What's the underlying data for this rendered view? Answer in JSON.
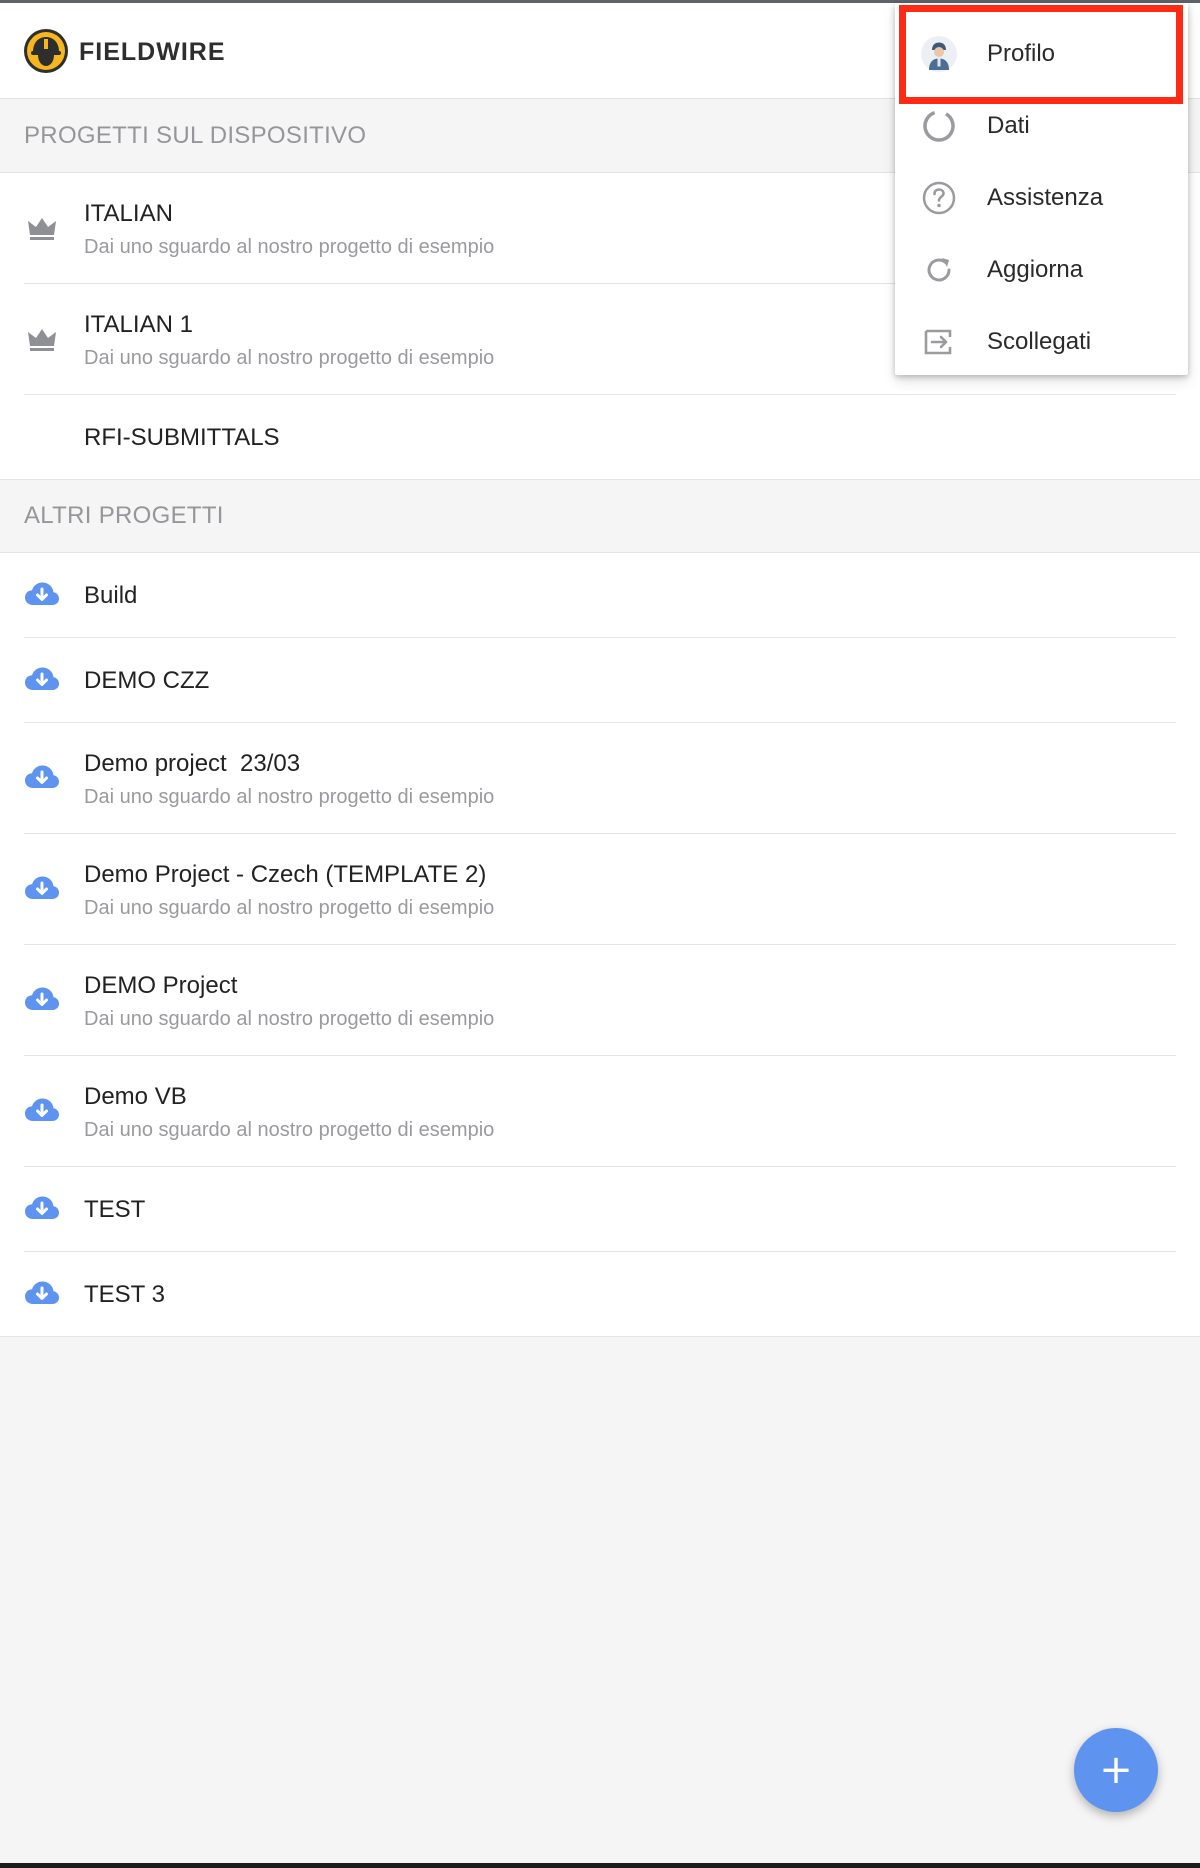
{
  "app": {
    "brand": "FIELDWIRE"
  },
  "sections": {
    "device_title": "PROGETTI SUL DISPOSITIVO",
    "other_title": "ALTRI PROGETTI"
  },
  "device_projects": [
    {
      "name": "ITALIAN",
      "subtitle": "Dai uno sguardo al nostro progetto di esempio",
      "icon": "crown-icon"
    },
    {
      "name": "ITALIAN 1",
      "subtitle": "Dai uno sguardo al nostro progetto di esempio",
      "icon": "crown-icon"
    },
    {
      "name": "RFI-SUBMITTALS",
      "subtitle": "",
      "icon": ""
    }
  ],
  "other_projects": [
    {
      "name": "Build",
      "subtitle": "",
      "icon": "cloud-download-icon"
    },
    {
      "name": "DEMO CZZ",
      "subtitle": "",
      "icon": "cloud-download-icon"
    },
    {
      "name": "Demo project  23/03",
      "subtitle": "Dai uno sguardo al nostro progetto di esempio",
      "icon": "cloud-download-icon"
    },
    {
      "name": "Demo Project - Czech (TEMPLATE 2)",
      "subtitle": "Dai uno sguardo al nostro progetto di esempio",
      "icon": "cloud-download-icon"
    },
    {
      "name": "DEMO Project",
      "subtitle": "Dai uno sguardo al nostro progetto di esempio",
      "icon": "cloud-download-icon"
    },
    {
      "name": "Demo VB",
      "subtitle": "Dai uno sguardo al nostro progetto di esempio",
      "icon": "cloud-download-icon"
    },
    {
      "name": "TEST",
      "subtitle": "",
      "icon": "cloud-download-icon"
    },
    {
      "name": "TEST 3",
      "subtitle": "",
      "icon": "cloud-download-icon"
    }
  ],
  "menu": {
    "items": [
      {
        "label": "Profilo",
        "icon": "avatar-icon"
      },
      {
        "label": "Dati",
        "icon": "data-circle-icon"
      },
      {
        "label": "Assistenza",
        "icon": "help-icon"
      },
      {
        "label": "Aggiorna",
        "icon": "refresh-icon"
      },
      {
        "label": "Scollegati",
        "icon": "logout-icon"
      }
    ],
    "highlighted_item": "Profilo"
  },
  "fab": {
    "label": "+"
  },
  "colors": {
    "accent_blue": "#5e93f0",
    "highlight_red": "#fe2a14",
    "logo_yellow": "#f5b61f",
    "muted_gray": "#95969a"
  }
}
